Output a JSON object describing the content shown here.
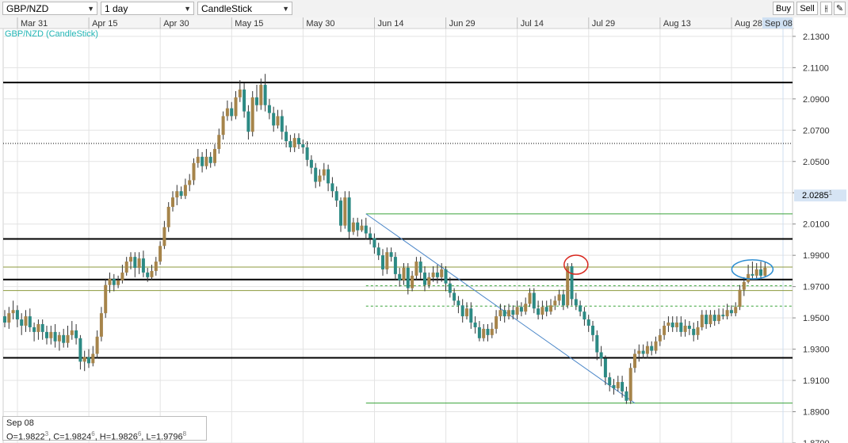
{
  "toolbar": {
    "symbol": "GBP/NZD",
    "interval": "1 day",
    "chart_style": "CandleStick",
    "buy_label": "Buy",
    "sell_label": "Sell",
    "tools_icon": "candle-tools-icon",
    "draw_icon": "pencil-icon"
  },
  "colors": {
    "bull": "#a6844a",
    "bear": "#2c8a84",
    "grid": "#e3e3e3",
    "hline": "#000000",
    "green_line": "#3aa33a",
    "olive_line": "#8c9a3c",
    "trend": "#4a86c8",
    "red_circle": "#d8261d",
    "blue_circle": "#2d8ed2",
    "price_tag": "#d6e4f4"
  },
  "chart_data": {
    "type": "candlestick",
    "title": "GBP/NZD (CandleStick)",
    "ylim": [
      1.87,
      2.135
    ],
    "y_ticks": [
      "2.1300",
      "2.1100",
      "2.0900",
      "2.0700",
      "2.0500",
      "2.0300",
      "2.0100",
      "1.9900",
      "1.9700",
      "1.9500",
      "1.9300",
      "1.9100",
      "1.8900",
      "1.8700"
    ],
    "x_ticks": [
      "Mar 31",
      "Apr 15",
      "Apr 30",
      "May 15",
      "May 30",
      "Jun 14",
      "Jun 29",
      "Jul 14",
      "Jul 29",
      "Aug 13",
      "Aug 28",
      "Sep 08"
    ],
    "current_price": "2.0285",
    "current_price_sup": "1",
    "last_bar": {
      "date": "Sep 08",
      "open": "1.9822",
      "open_sup": "3",
      "close": "1.9824",
      "close_sup": "6",
      "high": "1.9826",
      "high_sup": "6",
      "low": "1.9796",
      "low_sup": "8"
    },
    "horizontal_lines": [
      {
        "value": 2.1005,
        "style": "solid",
        "color": "black"
      },
      {
        "value": 2.0615,
        "style": "dotted",
        "color": "black"
      },
      {
        "value": 2.0005,
        "style": "solid",
        "color": "black"
      },
      {
        "value": 1.9745,
        "style": "solid",
        "color": "black"
      },
      {
        "value": 1.9245,
        "style": "solid",
        "color": "black"
      },
      {
        "value": 1.9825,
        "style": "solid",
        "color": "olive"
      },
      {
        "value": 1.9675,
        "style": "solid",
        "color": "olive"
      },
      {
        "value": 2.0165,
        "style": "solid",
        "color": "green",
        "from_index": 86
      },
      {
        "value": 1.8955,
        "style": "solid",
        "color": "green",
        "from_index": 86
      },
      {
        "value": 1.9705,
        "style": "dashed",
        "color": "green",
        "from_index": 86
      },
      {
        "value": 1.9575,
        "style": "dashed",
        "color": "green",
        "from_index": 86
      }
    ],
    "trendline": {
      "from_index": 86,
      "from_value": 2.0165,
      "to_index": 150,
      "to_value": 1.8955
    },
    "circles": [
      {
        "index": 136,
        "value": 1.984,
        "color": "red"
      },
      {
        "index": 178,
        "value": 1.981,
        "color": "blue"
      }
    ],
    "candles": [
      [
        1.951,
        1.947,
        1.955,
        1.944
      ],
      [
        1.947,
        1.953,
        1.957,
        1.943
      ],
      [
        1.953,
        1.955,
        1.961,
        1.949
      ],
      [
        1.955,
        1.949,
        1.958,
        1.944
      ],
      [
        1.949,
        1.945,
        1.953,
        1.939
      ],
      [
        1.945,
        1.951,
        1.955,
        1.941
      ],
      [
        1.951,
        1.944,
        1.956,
        1.941
      ],
      [
        1.944,
        1.941,
        1.947,
        1.935
      ],
      [
        1.941,
        1.946,
        1.949,
        1.936
      ],
      [
        1.946,
        1.941,
        1.949,
        1.936
      ],
      [
        1.941,
        1.937,
        1.945,
        1.933
      ],
      [
        1.937,
        1.941,
        1.945,
        1.933
      ],
      [
        1.941,
        1.935,
        1.946,
        1.931
      ],
      [
        1.935,
        1.939,
        1.941,
        1.929
      ],
      [
        1.939,
        1.934,
        1.943,
        1.931
      ],
      [
        1.934,
        1.939,
        1.945,
        1.931
      ],
      [
        1.939,
        1.942,
        1.948,
        1.936
      ],
      [
        1.942,
        1.937,
        1.946,
        1.933
      ],
      [
        1.937,
        1.922,
        1.939,
        1.917
      ],
      [
        1.922,
        1.925,
        1.929,
        1.916
      ],
      [
        1.925,
        1.921,
        1.93,
        1.918
      ],
      [
        1.921,
        1.927,
        1.932,
        1.919
      ],
      [
        1.927,
        1.938,
        1.942,
        1.924
      ],
      [
        1.938,
        1.953,
        1.957,
        1.935
      ],
      [
        1.953,
        1.971,
        1.975,
        1.95
      ],
      [
        1.971,
        1.975,
        1.979,
        1.966
      ],
      [
        1.975,
        1.971,
        1.978,
        1.967
      ],
      [
        1.971,
        1.974,
        1.977,
        1.969
      ],
      [
        1.974,
        1.979,
        1.984,
        1.972
      ],
      [
        1.979,
        1.986,
        1.989,
        1.977
      ],
      [
        1.986,
        1.989,
        1.992,
        1.981
      ],
      [
        1.989,
        1.982,
        1.992,
        1.976
      ],
      [
        1.982,
        1.988,
        1.992,
        1.978
      ],
      [
        1.988,
        1.979,
        1.993,
        1.976
      ],
      [
        1.979,
        1.976,
        1.982,
        1.973
      ],
      [
        1.976,
        1.98,
        1.984,
        1.974
      ],
      [
        1.98,
        1.986,
        1.989,
        1.977
      ],
      [
        1.986,
        1.996,
        1.999,
        1.984
      ],
      [
        1.996,
        2.008,
        2.012,
        1.994
      ],
      [
        2.008,
        2.021,
        2.024,
        2.005
      ],
      [
        2.021,
        2.027,
        2.031,
        2.018
      ],
      [
        2.027,
        2.031,
        2.035,
        2.022
      ],
      [
        2.031,
        2.028,
        2.034,
        2.026
      ],
      [
        2.028,
        2.035,
        2.039,
        2.026
      ],
      [
        2.035,
        2.038,
        2.042,
        2.031
      ],
      [
        2.038,
        2.049,
        2.052,
        2.035
      ],
      [
        2.049,
        2.053,
        2.058,
        2.046
      ],
      [
        2.053,
        2.047,
        2.056,
        2.043
      ],
      [
        2.047,
        2.053,
        2.058,
        2.045
      ],
      [
        2.053,
        2.049,
        2.056,
        2.046
      ],
      [
        2.049,
        2.058,
        2.061,
        2.047
      ],
      [
        2.058,
        2.067,
        2.071,
        2.055
      ],
      [
        2.067,
        2.079,
        2.082,
        2.064
      ],
      [
        2.079,
        2.084,
        2.089,
        2.076
      ],
      [
        2.084,
        2.079,
        2.088,
        2.076
      ],
      [
        2.079,
        2.091,
        2.095,
        2.077
      ],
      [
        2.091,
        2.096,
        2.102,
        2.088
      ],
      [
        2.096,
        2.082,
        2.1,
        2.078
      ],
      [
        2.082,
        2.069,
        2.086,
        2.064
      ],
      [
        2.069,
        2.091,
        2.095,
        2.066
      ],
      [
        2.091,
        2.086,
        2.099,
        2.082
      ],
      [
        2.086,
        2.099,
        2.103,
        2.083
      ],
      [
        2.099,
        2.086,
        2.106,
        2.082
      ],
      [
        2.086,
        2.081,
        2.09,
        2.077
      ],
      [
        2.081,
        2.073,
        2.085,
        2.069
      ],
      [
        2.073,
        2.079,
        2.083,
        2.071
      ],
      [
        2.079,
        2.069,
        2.083,
        2.064
      ],
      [
        2.069,
        2.063,
        2.073,
        2.059
      ],
      [
        2.063,
        2.059,
        2.067,
        2.056
      ],
      [
        2.059,
        2.065,
        2.068,
        2.056
      ],
      [
        2.065,
        2.061,
        2.068,
        2.058
      ],
      [
        2.061,
        2.059,
        2.064,
        2.055
      ],
      [
        2.059,
        2.051,
        2.063,
        2.047
      ],
      [
        2.051,
        2.046,
        2.054,
        2.042
      ],
      [
        2.046,
        2.037,
        2.049,
        2.033
      ],
      [
        2.037,
        2.041,
        2.045,
        2.034
      ],
      [
        2.041,
        2.045,
        2.049,
        2.038
      ],
      [
        2.045,
        2.036,
        2.048,
        2.031
      ],
      [
        2.036,
        2.031,
        2.04,
        2.027
      ],
      [
        2.031,
        2.025,
        2.034,
        2.021
      ],
      [
        2.025,
        2.009,
        2.027,
        2.005
      ],
      [
        2.009,
        2.027,
        2.031,
        2.007
      ],
      [
        2.027,
        2.005,
        2.031,
        2.001
      ],
      [
        2.005,
        2.011,
        2.014,
        2.003
      ],
      [
        2.011,
        2.006,
        2.014,
        2.002
      ],
      [
        2.006,
        2.009,
        2.013,
        2.005
      ],
      [
        2.009,
        2.004,
        2.014,
        2.0
      ],
      [
        2.004,
        2.001,
        2.008,
        1.997
      ],
      [
        2.001,
        1.995,
        2.004,
        1.991
      ],
      [
        1.995,
        1.99,
        1.998,
        1.987
      ],
      [
        1.99,
        1.981,
        1.994,
        1.977
      ],
      [
        1.981,
        1.992,
        1.995,
        1.978
      ],
      [
        1.992,
        1.989,
        1.995,
        1.986
      ],
      [
        1.989,
        1.978,
        1.992,
        1.974
      ],
      [
        1.978,
        1.974,
        1.982,
        1.97
      ],
      [
        1.974,
        1.982,
        1.985,
        1.971
      ],
      [
        1.982,
        1.969,
        1.985,
        1.965
      ],
      [
        1.969,
        1.977,
        1.98,
        1.967
      ],
      [
        1.977,
        1.986,
        1.989,
        1.974
      ],
      [
        1.986,
        1.979,
        1.989,
        1.975
      ],
      [
        1.979,
        1.971,
        1.983,
        1.967
      ],
      [
        1.971,
        1.976,
        1.979,
        1.969
      ],
      [
        1.976,
        1.979,
        1.983,
        1.973
      ],
      [
        1.979,
        1.976,
        1.984,
        1.972
      ],
      [
        1.976,
        1.981,
        1.985,
        1.973
      ],
      [
        1.981,
        1.972,
        1.983,
        1.967
      ],
      [
        1.972,
        1.966,
        1.976,
        1.963
      ],
      [
        1.966,
        1.961,
        1.969,
        1.958
      ],
      [
        1.961,
        1.958,
        1.964,
        1.953
      ],
      [
        1.958,
        1.951,
        1.962,
        1.947
      ],
      [
        1.951,
        1.956,
        1.96,
        1.949
      ],
      [
        1.956,
        1.947,
        1.96,
        1.943
      ],
      [
        1.947,
        1.944,
        1.951,
        1.94
      ],
      [
        1.944,
        1.937,
        1.948,
        1.935
      ],
      [
        1.937,
        1.943,
        1.946,
        1.935
      ],
      [
        1.943,
        1.939,
        1.946,
        1.935
      ],
      [
        1.939,
        1.943,
        1.947,
        1.937
      ],
      [
        1.943,
        1.951,
        1.955,
        1.94
      ],
      [
        1.951,
        1.955,
        1.959,
        1.948
      ],
      [
        1.955,
        1.951,
        1.958,
        1.947
      ],
      [
        1.951,
        1.955,
        1.959,
        1.949
      ],
      [
        1.955,
        1.952,
        1.958,
        1.949
      ],
      [
        1.952,
        1.957,
        1.961,
        1.949
      ],
      [
        1.957,
        1.954,
        1.96,
        1.951
      ],
      [
        1.954,
        1.959,
        1.963,
        1.952
      ],
      [
        1.959,
        1.966,
        1.969,
        1.957
      ],
      [
        1.966,
        1.956,
        1.969,
        1.953
      ],
      [
        1.956,
        1.952,
        1.961,
        1.949
      ],
      [
        1.952,
        1.957,
        1.961,
        1.949
      ],
      [
        1.957,
        1.954,
        1.961,
        1.951
      ],
      [
        1.954,
        1.958,
        1.962,
        1.952
      ],
      [
        1.958,
        1.961,
        1.964,
        1.955
      ],
      [
        1.961,
        1.965,
        1.968,
        1.958
      ],
      [
        1.965,
        1.958,
        1.968,
        1.955
      ],
      [
        1.958,
        1.983,
        1.985,
        1.956
      ],
      [
        1.983,
        1.962,
        1.985,
        1.958
      ],
      [
        1.962,
        1.958,
        1.966,
        1.955
      ],
      [
        1.958,
        1.954,
        1.961,
        1.951
      ],
      [
        1.954,
        1.949,
        1.957,
        1.945
      ],
      [
        1.949,
        1.945,
        1.952,
        1.941
      ],
      [
        1.945,
        1.939,
        1.948,
        1.935
      ],
      [
        1.939,
        1.928,
        1.942,
        1.923
      ],
      [
        1.928,
        1.924,
        1.932,
        1.919
      ],
      [
        1.924,
        1.912,
        1.926,
        1.907
      ],
      [
        1.912,
        1.907,
        1.915,
        1.903
      ],
      [
        1.907,
        1.905,
        1.911,
        1.901
      ],
      [
        1.905,
        1.909,
        1.913,
        1.903
      ],
      [
        1.909,
        1.903,
        1.913,
        1.899
      ],
      [
        1.903,
        1.897,
        1.906,
        1.895
      ],
      [
        1.897,
        1.918,
        1.921,
        1.895
      ],
      [
        1.918,
        1.927,
        1.93,
        1.915
      ],
      [
        1.927,
        1.929,
        1.933,
        1.922
      ],
      [
        1.929,
        1.927,
        1.933,
        1.924
      ],
      [
        1.927,
        1.932,
        1.935,
        1.924
      ],
      [
        1.932,
        1.929,
        1.935,
        1.926
      ],
      [
        1.929,
        1.935,
        1.938,
        1.927
      ],
      [
        1.935,
        1.939,
        1.943,
        1.932
      ],
      [
        1.939,
        1.945,
        1.948,
        1.936
      ],
      [
        1.945,
        1.947,
        1.951,
        1.941
      ],
      [
        1.947,
        1.944,
        1.951,
        1.941
      ],
      [
        1.944,
        1.947,
        1.951,
        1.941
      ],
      [
        1.947,
        1.941,
        1.951,
        1.938
      ],
      [
        1.941,
        1.945,
        1.949,
        1.938
      ],
      [
        1.945,
        1.943,
        1.948,
        1.939
      ],
      [
        1.943,
        1.939,
        1.947,
        1.935
      ],
      [
        1.939,
        1.944,
        1.948,
        1.936
      ],
      [
        1.944,
        1.952,
        1.955,
        1.942
      ],
      [
        1.952,
        1.946,
        1.955,
        1.943
      ],
      [
        1.946,
        1.952,
        1.955,
        1.944
      ],
      [
        1.952,
        1.948,
        1.955,
        1.945
      ],
      [
        1.948,
        1.952,
        1.956,
        1.946
      ],
      [
        1.952,
        1.951,
        1.956,
        1.949
      ],
      [
        1.951,
        1.955,
        1.959,
        1.949
      ],
      [
        1.955,
        1.953,
        1.958,
        1.951
      ],
      [
        1.953,
        1.957,
        1.96,
        1.951
      ],
      [
        1.957,
        1.968,
        1.971,
        1.955
      ],
      [
        1.968,
        1.973,
        1.976,
        1.964
      ],
      [
        1.973,
        1.978,
        1.984,
        1.972
      ],
      [
        1.978,
        1.977,
        1.986,
        1.975
      ],
      [
        1.977,
        1.981,
        1.985,
        1.975
      ],
      [
        1.981,
        1.977,
        1.986,
        1.974
      ],
      [
        1.977,
        1.982,
        1.986,
        1.976
      ]
    ]
  }
}
